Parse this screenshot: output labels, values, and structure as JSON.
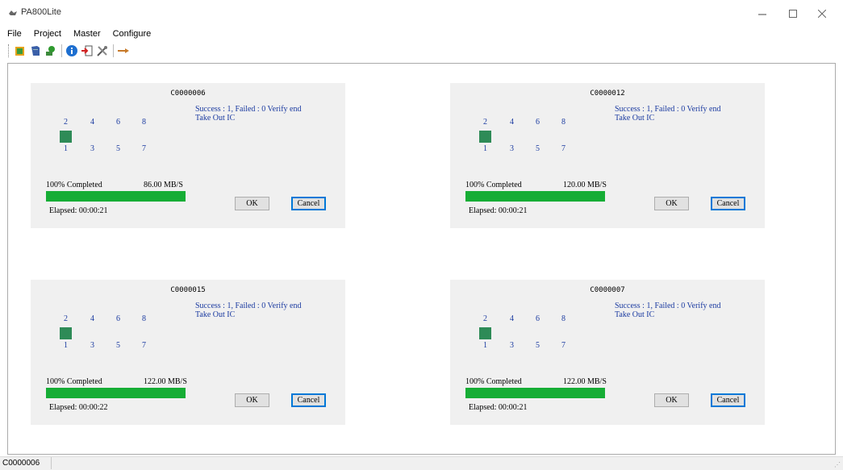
{
  "window": {
    "title": "PA800Lite"
  },
  "menu": [
    "File",
    "Project",
    "Master",
    "Configure"
  ],
  "toolbar": {
    "icons": [
      "open-project-icon",
      "book-icon",
      "program-icon",
      "info-icon",
      "exit-icon",
      "tools-icon",
      "pointer-icon"
    ]
  },
  "panels": [
    {
      "title": "C0000006",
      "status": "Success : 1, Failed : 0 Verify end",
      "status2": "Take Out IC",
      "percent": "100% Completed",
      "speed": "86.00 MB/S",
      "elapsed": "Elapsed: 00:00:21",
      "progress": 1.0
    },
    {
      "title": "C0000012",
      "status": "Success : 1, Failed : 0 Verify end",
      "status2": "Take Out IC",
      "percent": "100% Completed",
      "speed": "120.00 MB/S",
      "elapsed": "Elapsed: 00:00:21",
      "progress": 1.0
    },
    {
      "title": "C0000015",
      "status": "Success : 1, Failed : 0 Verify end",
      "status2": "Take Out IC",
      "percent": "100% Completed",
      "speed": "122.00 MB/S",
      "elapsed": "Elapsed: 00:00:22",
      "progress": 1.0
    },
    {
      "title": "C0000007",
      "status": "Success : 1, Failed : 0 Verify end",
      "status2": "Take Out IC",
      "percent": "100% Completed",
      "speed": "122.00 MB/S",
      "elapsed": "Elapsed: 00:00:21",
      "progress": 1.0
    }
  ],
  "slots": {
    "top": [
      "2",
      "4",
      "6",
      "8"
    ],
    "bottom": [
      "1",
      "3",
      "5",
      "7"
    ]
  },
  "buttons": {
    "ok": "OK",
    "cancel": "Cancel"
  },
  "statusbar": {
    "text": "C0000006"
  },
  "colors": {
    "progress": "#16ad35",
    "slot_active": "#2e8b57",
    "status_text": "#1a3aa0",
    "panel_bg": "#f0f0f0"
  }
}
